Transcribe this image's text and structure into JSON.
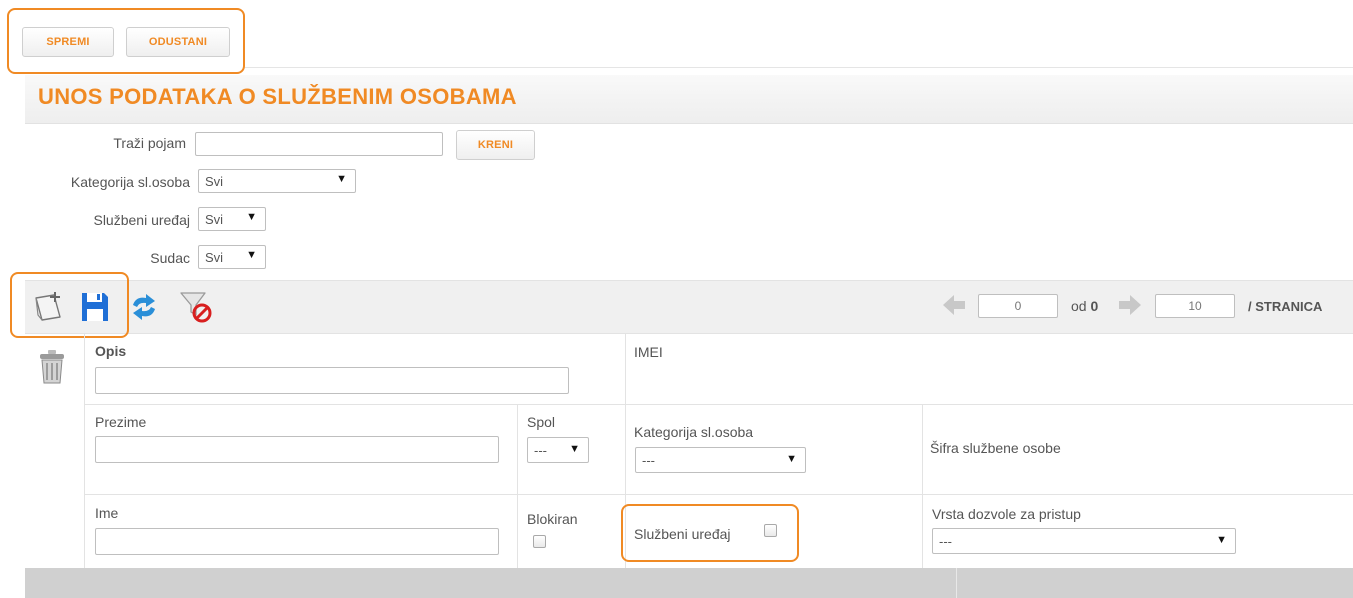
{
  "toolbar": {
    "save_label": "SPREMI",
    "cancel_label": "ODUSTANI"
  },
  "page": {
    "title": "UNOS PODATAKA O SLUŽBENIM OSOBAMA"
  },
  "filters": {
    "search_label": "Traži pojam",
    "search_value": "",
    "go_label": "KRENI",
    "category_label": "Kategorija sl.osoba",
    "category_value": "Svi",
    "device_label": "Službeni uređaj",
    "device_value": "Svi",
    "judge_label": "Sudac",
    "judge_value": "Svi"
  },
  "pager": {
    "current_page": "0",
    "of_label": "od",
    "total_pages": "0",
    "page_size": "10",
    "per_page_label": "/ STRANICA"
  },
  "form": {
    "opis_label": "Opis",
    "imei_label": "IMEI",
    "prezime_label": "Prezime",
    "spol_label": "Spol",
    "spol_value": "---",
    "kategorija_label": "Kategorija sl.osoba",
    "kategorija_value": "---",
    "sifra_label": "Šifra službene osobe",
    "ime_label": "Ime",
    "blokiran_label": "Blokiran",
    "sluzbeni_uredaj_label": "Službeni uređaj",
    "vrsta_dozvole_label": "Vrsta dozvole za pristup",
    "vrsta_dozvole_value": "---"
  },
  "colors": {
    "accent": "#f08a24",
    "toolbar_bg": "#f0f0f0",
    "footer_bg": "#d0d0d0"
  },
  "icons": [
    "new-record-icon",
    "save-icon",
    "refresh-icon",
    "clear-filter-icon",
    "trash-icon",
    "prev-arrow-icon",
    "next-arrow-icon"
  ]
}
